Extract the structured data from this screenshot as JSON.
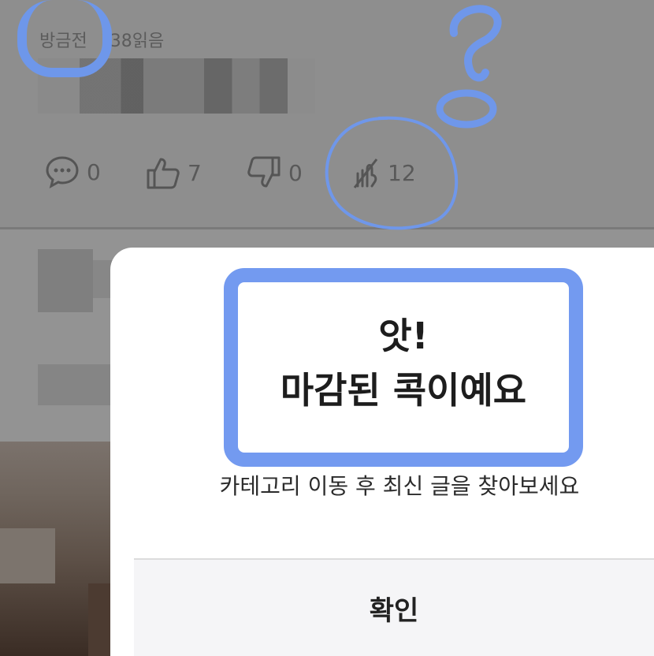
{
  "post": {
    "time": "방금전",
    "reads": "38읽음",
    "actions": {
      "comments": "0",
      "likes": "7",
      "dislikes": "0",
      "shares": "12"
    }
  },
  "dialog": {
    "title_line1": "앗!",
    "title_line2": "마감된 콕이예요",
    "message": "카테고리 이동 후 최신 글을 찾아보세요",
    "confirm_label": "확인"
  },
  "annotation_colors": {
    "highlight": "#739af0"
  }
}
